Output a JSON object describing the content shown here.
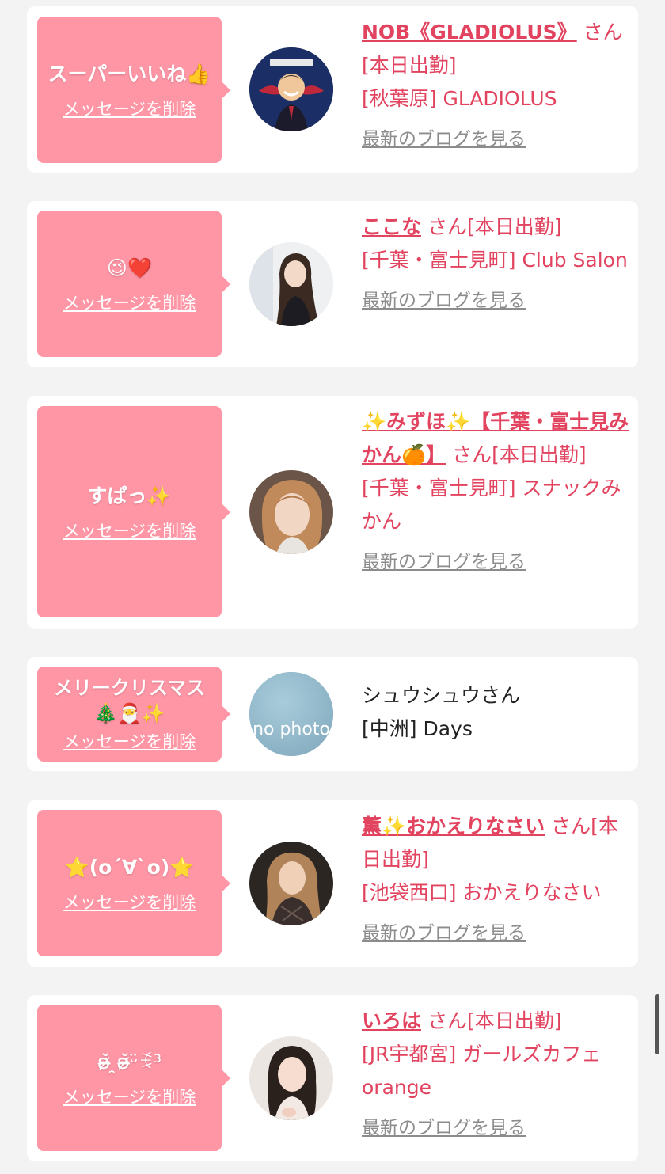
{
  "delete_label": "メッセージを削除",
  "blog_label": "最新のブログを見る",
  "san_suffix": "さん",
  "cards": [
    {
      "message": "スーパーいいね👍",
      "name": "NOB《GLADIOLUS》",
      "status": "[本日出勤]",
      "shop": "[秋葉原] GLADIOLUS",
      "avatar_icon": "avatar-red-wings-caricature"
    },
    {
      "message": "😉❤️",
      "name": "ここな",
      "status": "[本日出勤]",
      "shop": "[千葉・富士見町] Club Salon",
      "avatar_icon": "avatar-woman-photo"
    },
    {
      "message": "すぱっ✨",
      "name": "✨みずほ✨【千葉・富士見みかん🍊】",
      "status": "[本日出勤]",
      "shop": "[千葉・富士見町] スナックみかん",
      "avatar_icon": "avatar-woman-photo"
    },
    {
      "message": "メリークリスマス🎄🎅✨",
      "name": "シュウシュウさん",
      "shop": "[中洲] Days",
      "avatar_text": "no photo",
      "avatar_icon": "no-photo-placeholder"
    },
    {
      "message": "⭐(o´∀`o)⭐",
      "name": "薫✨おかえりなさい",
      "status": "[本日出勤]",
      "shop": "[池袋西口] おかえりなさい",
      "avatar_icon": "avatar-woman-photo"
    },
    {
      "message": "ʚ̴̶̷̆ ̯ʚ̴̶̷̆ᵕ̈ꉂ³",
      "name": "いろは",
      "status": "[本日出勤]",
      "shop": "[JR宇都宮] ガールズカフェ orange",
      "avatar_icon": "avatar-woman-photo"
    }
  ],
  "colors": {
    "accent": "#e2435f",
    "bubble": "#ff96a6",
    "link_gray": "#8c8c8c",
    "background": "#f3f3f3"
  }
}
